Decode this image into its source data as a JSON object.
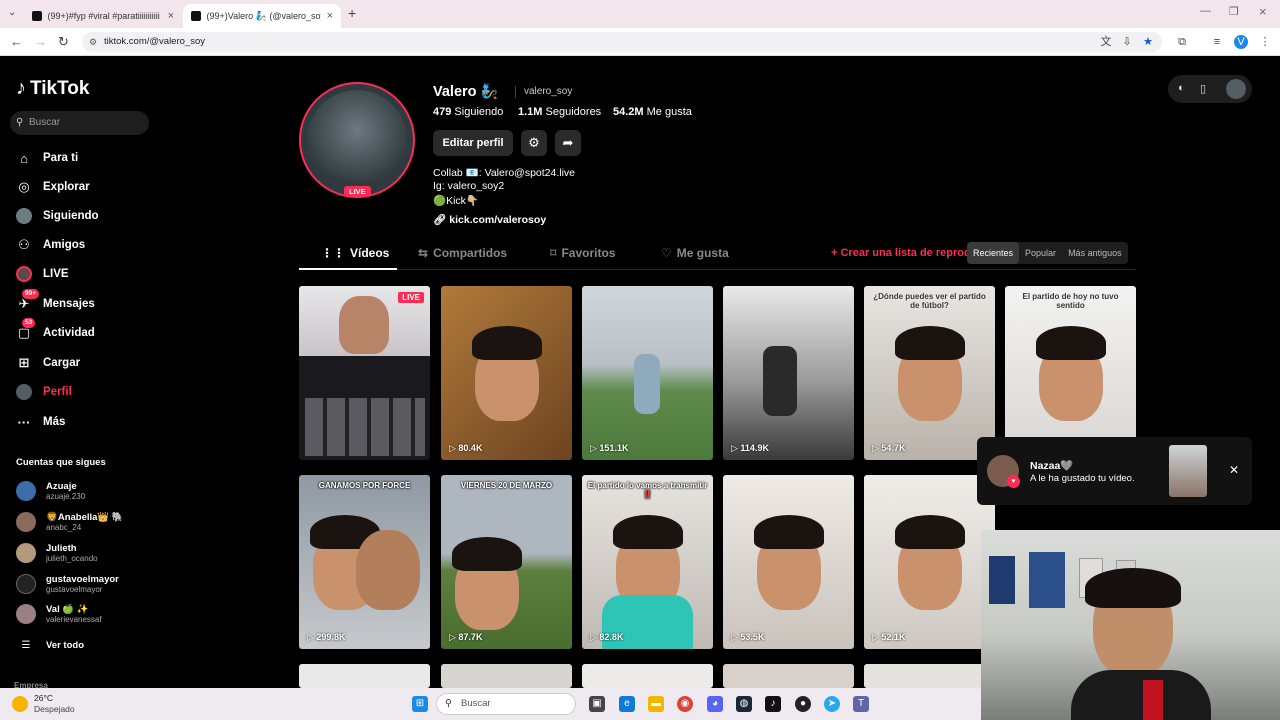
{
  "browser": {
    "tabs": [
      {
        "title": "(99+)#fyp #viral #paratiiiiiiiiiii"
      },
      {
        "title": "(99+)Valero 🧞 (@valero_soy) |"
      }
    ],
    "url": "tiktok.com/@valero_soy",
    "profile_initial": "V"
  },
  "sidebar": {
    "logo": "TikTok",
    "search_placeholder": "Buscar",
    "items": [
      {
        "label": "Para ti",
        "icon": "home-icon"
      },
      {
        "label": "Explorar",
        "icon": "compass-icon"
      },
      {
        "label": "Siguiendo",
        "icon": "following-avatar-icon"
      },
      {
        "label": "Amigos",
        "icon": "friends-icon"
      },
      {
        "label": "LIVE",
        "icon": "live-icon"
      },
      {
        "label": "Mensajes",
        "icon": "messages-icon",
        "badge": "99+"
      },
      {
        "label": "Actividad",
        "icon": "activity-icon",
        "badge": "53"
      },
      {
        "label": "Cargar",
        "icon": "upload-icon"
      },
      {
        "label": "Perfil",
        "icon": "profile-avatar-icon"
      },
      {
        "label": "Más",
        "icon": "more-icon"
      }
    ],
    "following_title": "Cuentas que sigues",
    "accounts": [
      {
        "name": "Azuaje",
        "handle": "azuaje.230"
      },
      {
        "name": "🦁Anabella👑 🐘",
        "handle": "anabc_24"
      },
      {
        "name": "Julieth",
        "handle": "julieth_ocando"
      },
      {
        "name": "gustavoelmayor",
        "handle": "gustavoelmayor"
      },
      {
        "name": "Val 🍏 ✨",
        "handle": "valerievanessaf"
      }
    ],
    "see_all": "Ver todo",
    "footer": "Empresa"
  },
  "profile": {
    "display_name": "Valero 🧞",
    "username": "valero_soy",
    "live_chip": "LIVE",
    "following_count": "479",
    "following_label": "Siguiendo",
    "followers_count": "1.1M",
    "followers_label": "Seguidores",
    "likes_count": "54.2M",
    "likes_label": "Me gusta",
    "edit_button": "Editar perfil",
    "bio_lines": [
      "Collab 📧: Valero@spot24.live",
      "Ig: valero_soy2",
      "🟢Kick👇🏼"
    ],
    "link": "kick.com/valerosoy"
  },
  "tabs": {
    "videos": "Vídeos",
    "reposts": "Compartidos",
    "favorites": "Favoritos",
    "liked": "Me gusta",
    "create_list": "+ Crear una lista de reprod",
    "sort": [
      "Recientes",
      "Popular",
      "Más antiguos"
    ]
  },
  "videos": [
    {
      "views": "",
      "caption": "",
      "live": "LIVE"
    },
    {
      "views": "80.4K",
      "caption": ""
    },
    {
      "views": "151.1K",
      "caption": ""
    },
    {
      "views": "114.9K",
      "caption": ""
    },
    {
      "views": "54.7K",
      "caption": "¿Dónde puedes ver el partido de fútbol?"
    },
    {
      "views": "",
      "caption": "El partido de hoy no tuvo sentido"
    },
    {
      "views": "299.8K",
      "caption": "GANAMOS POR FORCE"
    },
    {
      "views": "87.7K",
      "caption": "VIERNES 20 DE MARZO"
    },
    {
      "views": "82.8K",
      "caption": "El partido lo vamos a transmitir ‼️"
    },
    {
      "views": "53.5K",
      "caption": ""
    },
    {
      "views": "52.1K",
      "caption": ""
    }
  ],
  "notification": {
    "name": "Nazaa🩶",
    "text": "A le ha gustado tu vídeo."
  },
  "taskbar": {
    "temperature": "26°C",
    "weather": "Despejado",
    "search": "Buscar"
  }
}
